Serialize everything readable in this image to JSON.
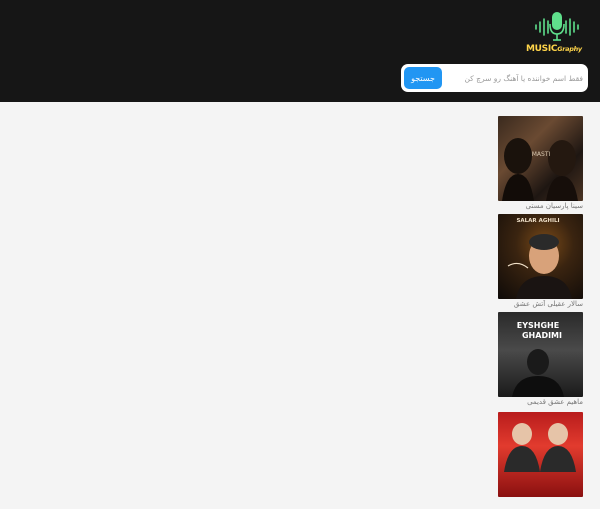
{
  "brand": {
    "logo_main": "MUSIC",
    "logo_sub": "Graphy",
    "colors": {
      "header_bg": "#161616",
      "logo_green": "#5fe08c",
      "logo_yellow": "#ffd54a",
      "accent": "#2196f3"
    }
  },
  "search": {
    "placeholder": "فقط اسم خواننده یا آهنگ رو سرچ کن",
    "button_label": "جستجو",
    "icon": "microphone-icon"
  },
  "tracks": [
    {
      "cover_text": "MASTI",
      "caption": "سینا پارسیان مستی"
    },
    {
      "cover_text": "SALAR AGHILI",
      "caption": "سالار عقیلی آتش عشق"
    },
    {
      "cover_text_1": "EYSHGHE",
      "cover_text_2": "GHADIMI",
      "caption": "ماهیم عشق قدیمی"
    },
    {
      "cover_text": "",
      "caption": ""
    }
  ]
}
